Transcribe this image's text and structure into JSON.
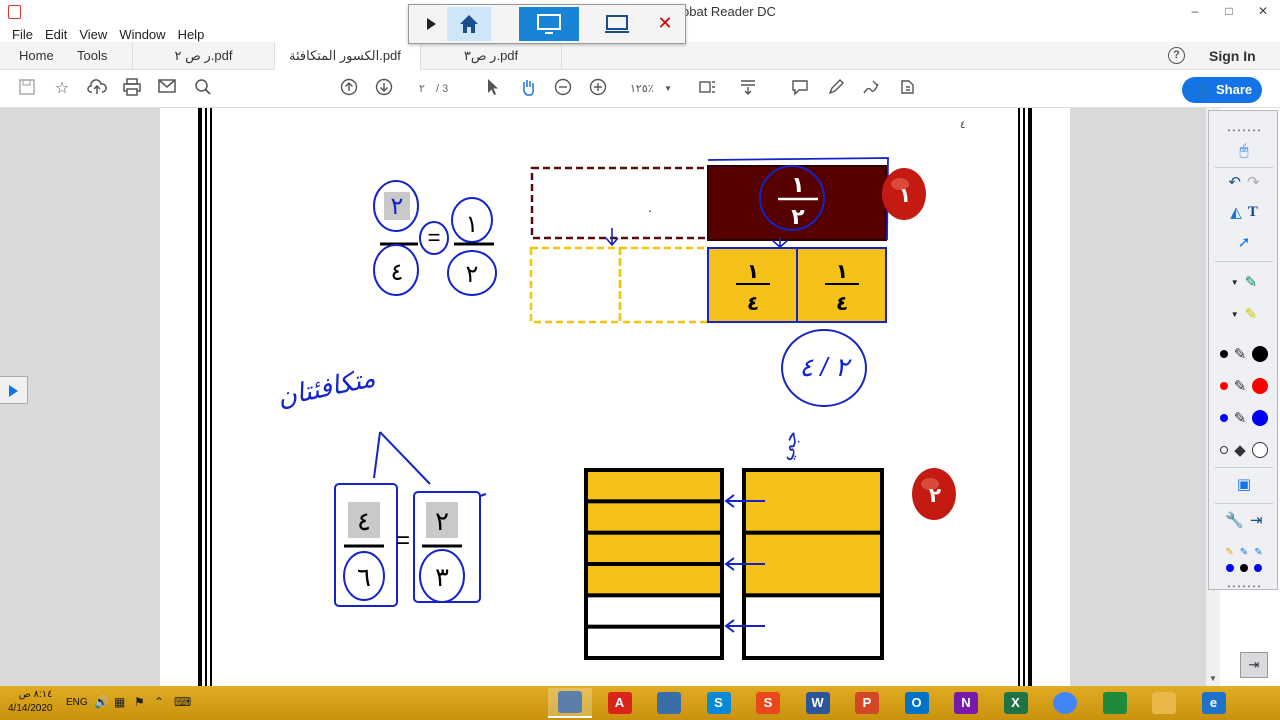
{
  "window": {
    "title": "obat Reader DC",
    "controls": [
      "–",
      "□",
      "✕"
    ],
    "doc_controls": [
      "–",
      "□",
      "✕"
    ]
  },
  "menu": [
    "File",
    "Edit",
    "View",
    "Window",
    "Help"
  ],
  "tabs": {
    "home": "Home",
    "tools": "Tools",
    "files": [
      {
        "label": "ر ص ٢.pdf",
        "active": false
      },
      {
        "label": "الكسور المتكافئة.pdf",
        "active": true
      },
      {
        "label": "ر ص٣.pdf",
        "active": false
      }
    ],
    "close_glyph": "✕",
    "help": "?",
    "sign_in": "Sign In"
  },
  "toolbar": {
    "current_page": "٢",
    "total_pages": "/ 3",
    "zoom": "١٢٥٪",
    "share": "Share"
  },
  "document": {
    "header_mark": "٤",
    "problem_1": {
      "badge": "١",
      "whole_fraction": {
        "num": "١",
        "den": "٢"
      },
      "quarter_cells": [
        {
          "num": "١",
          "den": "٤"
        },
        {
          "num": "١",
          "den": "٤"
        }
      ],
      "handwritten_equation": {
        "left": {
          "num": "١",
          "den": "٢"
        },
        "right": {
          "num": "٢",
          "den": "٤"
        }
      },
      "handwritten_answer": "٢ / ٤",
      "handwritten_word": "متكافئتان"
    },
    "problem_2": {
      "badge": "٢",
      "handwritten_mark": "جي",
      "equation": {
        "left": {
          "num": "٢",
          "den": "٣"
        },
        "right": {
          "num": "٤",
          "den": "٦"
        }
      },
      "left_bar_rows_shaded": 4,
      "left_bar_rows_total": 6,
      "right_bar_rows_shaded": 2,
      "right_bar_rows_total": 3
    }
  },
  "palette": {
    "colors": {
      "black": "#000000",
      "red": "#ff0000",
      "blue": "#0000ff",
      "white": "#ffffff",
      "teal": "#0a8a6a",
      "yellow": "#e6e600"
    }
  },
  "taskbar": {
    "time": "٨:١٤ ص",
    "date": "4/14/2020",
    "lang": "ENG",
    "apps": [
      {
        "icon": "app-window-icon",
        "letter": ""
      },
      {
        "icon": "acrobat-icon",
        "letter": "A"
      },
      {
        "icon": "app-icon",
        "letter": ""
      },
      {
        "icon": "skype-icon",
        "letter": "S"
      },
      {
        "icon": "slides-icon",
        "letter": "S"
      },
      {
        "icon": "word-icon",
        "letter": "W"
      },
      {
        "icon": "powerpoint-icon",
        "letter": "P"
      },
      {
        "icon": "outlook-icon",
        "letter": "O"
      },
      {
        "icon": "onenote-icon",
        "letter": "N"
      },
      {
        "icon": "excel-icon",
        "letter": "X"
      },
      {
        "icon": "chrome-icon",
        "letter": ""
      },
      {
        "icon": "spreadsheet-icon",
        "letter": ""
      },
      {
        "icon": "folder-icon",
        "letter": ""
      },
      {
        "icon": "edge-icon",
        "letter": "e"
      }
    ]
  }
}
